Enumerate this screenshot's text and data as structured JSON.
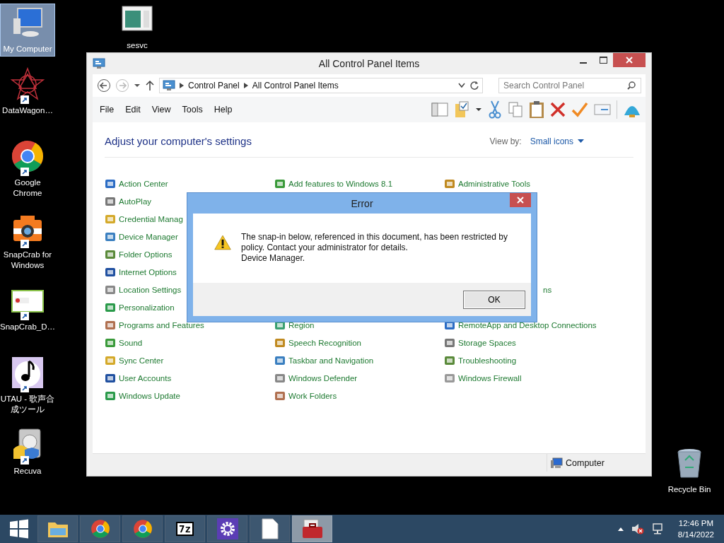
{
  "desktop": {
    "left_column": [
      {
        "label": "My Computer",
        "kind": "computer",
        "selected": true
      },
      {
        "label": "DataWagon…",
        "kind": "star",
        "selected": false
      },
      {
        "label": "Google Chrome",
        "kind": "chrome",
        "selected": false
      },
      {
        "label": "SnapCrab for Windows",
        "kind": "camera",
        "selected": false
      },
      {
        "label": "SnapCrab_D…",
        "kind": "screenshot",
        "selected": false
      },
      {
        "label": "UTAU - 歌声合成ツール",
        "kind": "note",
        "selected": false
      },
      {
        "label": "Recuva",
        "kind": "drive",
        "selected": false
      }
    ],
    "top_icon": {
      "label": "sesvc",
      "kind": "window",
      "selected": false
    },
    "corner_icon": {
      "label": "Recycle Bin",
      "kind": "bin",
      "selected": false
    }
  },
  "window": {
    "title": "All Control Panel Items",
    "address": [
      "Control Panel",
      "All Control Panel Items"
    ],
    "search": {
      "placeholder": "Search Control Panel"
    },
    "menu": [
      "File",
      "Edit",
      "View",
      "Tools",
      "Help"
    ],
    "heading": "Adjust your computer's settings",
    "view_by": {
      "label": "View by:",
      "value": "Small icons"
    },
    "rows": [
      {
        "column_1": {
          "label": "Action Center"
        },
        "column_2": {
          "label": "Add features to Windows 8.1"
        },
        "column_3": {
          "label": "Administrative Tools"
        }
      },
      {
        "column_1": {
          "label": "AutoPlay"
        }
      },
      {
        "column_1": {
          "label": "Credential Manag"
        }
      },
      {
        "column_1": {
          "label": "Device Manager"
        }
      },
      {
        "column_1": {
          "label": "Folder Options"
        }
      },
      {
        "column_1": {
          "label": "Internet Options"
        }
      },
      {
        "column_1": {
          "label": "Location Settings"
        },
        "column_3": {
          "label": "ns",
          "fragment": true
        }
      },
      {
        "column_1": {
          "label": "Personalization"
        }
      },
      {
        "column_1": {
          "label": "Programs and Features"
        },
        "column_2": {
          "label": "Region"
        },
        "column_3": {
          "label": "RemoteApp and Desktop Connections"
        }
      },
      {
        "column_1": {
          "label": "Sound"
        },
        "column_2": {
          "label": "Speech Recognition"
        },
        "column_3": {
          "label": "Storage Spaces"
        }
      },
      {
        "column_1": {
          "label": "Sync Center"
        },
        "column_2": {
          "label": "Taskbar and Navigation"
        },
        "column_3": {
          "label": "Troubleshooting"
        }
      },
      {
        "column_1": {
          "label": "User Accounts"
        },
        "column_2": {
          "label": "Windows Defender"
        },
        "column_3": {
          "label": "Windows Firewall"
        }
      },
      {
        "column_1": {
          "label": "Windows Update"
        },
        "column_2": {
          "label": "Work Folders"
        }
      }
    ],
    "status_bar": {
      "location": "Computer"
    }
  },
  "dialog": {
    "title": "Error",
    "lines": [
      "The snap-in below, referenced in this document, has been restricted by policy. Contact your administrator for details.",
      "Device Manager."
    ],
    "buttons": [
      "OK"
    ]
  },
  "taskbar": {
    "buttons": [
      {
        "kind": "explorer",
        "selected": false
      },
      {
        "kind": "chrome",
        "selected": false
      },
      {
        "kind": "chrome",
        "selected": false
      },
      {
        "kind": "archive",
        "label": "7z",
        "selected": false
      },
      {
        "kind": "gear",
        "selected": false
      },
      {
        "kind": "document",
        "selected": false
      },
      {
        "kind": "toolbox",
        "selected": true
      }
    ],
    "clock": {
      "time": "12:46 PM",
      "date": "8/14/2022"
    }
  }
}
